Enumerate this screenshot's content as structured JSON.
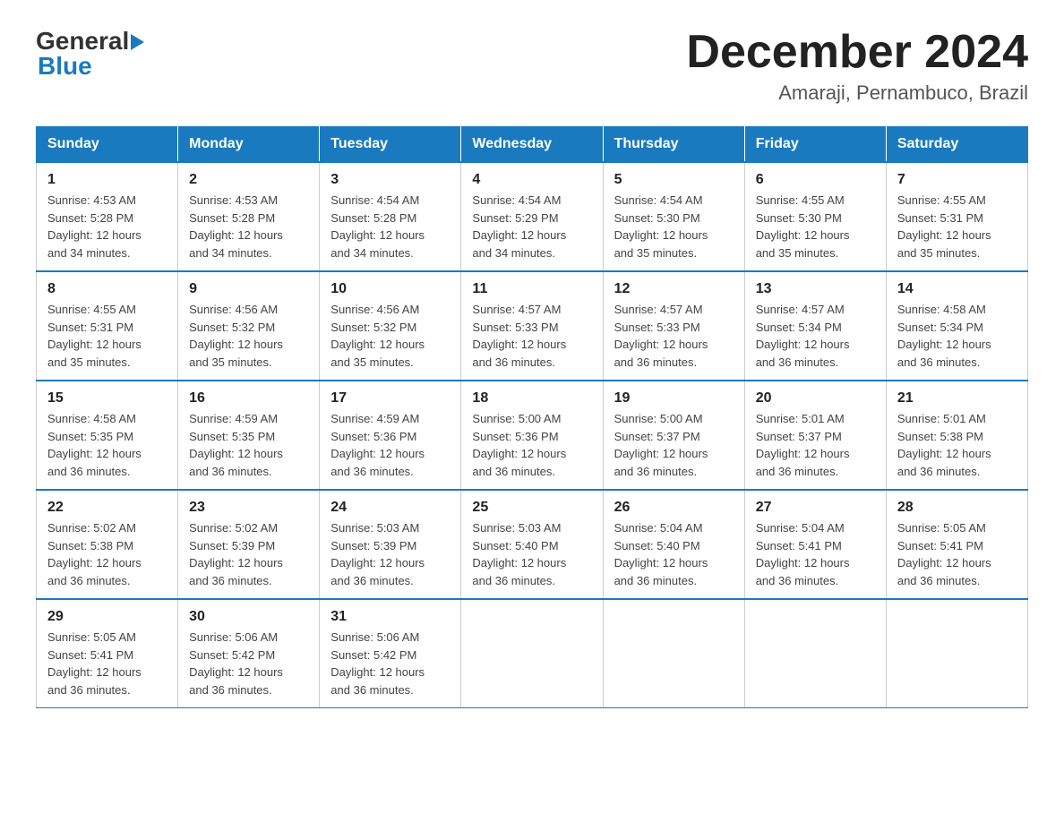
{
  "header": {
    "logo": {
      "general": "General",
      "blue": "Blue"
    },
    "title": "December 2024",
    "location": "Amaraji, Pernambuco, Brazil"
  },
  "days_of_week": [
    "Sunday",
    "Monday",
    "Tuesday",
    "Wednesday",
    "Thursday",
    "Friday",
    "Saturday"
  ],
  "weeks": [
    {
      "days": [
        {
          "num": "1",
          "sunrise": "4:53 AM",
          "sunset": "5:28 PM",
          "daylight": "12 hours and 34 minutes."
        },
        {
          "num": "2",
          "sunrise": "4:53 AM",
          "sunset": "5:28 PM",
          "daylight": "12 hours and 34 minutes."
        },
        {
          "num": "3",
          "sunrise": "4:54 AM",
          "sunset": "5:28 PM",
          "daylight": "12 hours and 34 minutes."
        },
        {
          "num": "4",
          "sunrise": "4:54 AM",
          "sunset": "5:29 PM",
          "daylight": "12 hours and 34 minutes."
        },
        {
          "num": "5",
          "sunrise": "4:54 AM",
          "sunset": "5:30 PM",
          "daylight": "12 hours and 35 minutes."
        },
        {
          "num": "6",
          "sunrise": "4:55 AM",
          "sunset": "5:30 PM",
          "daylight": "12 hours and 35 minutes."
        },
        {
          "num": "7",
          "sunrise": "4:55 AM",
          "sunset": "5:31 PM",
          "daylight": "12 hours and 35 minutes."
        }
      ]
    },
    {
      "days": [
        {
          "num": "8",
          "sunrise": "4:55 AM",
          "sunset": "5:31 PM",
          "daylight": "12 hours and 35 minutes."
        },
        {
          "num": "9",
          "sunrise": "4:56 AM",
          "sunset": "5:32 PM",
          "daylight": "12 hours and 35 minutes."
        },
        {
          "num": "10",
          "sunrise": "4:56 AM",
          "sunset": "5:32 PM",
          "daylight": "12 hours and 35 minutes."
        },
        {
          "num": "11",
          "sunrise": "4:57 AM",
          "sunset": "5:33 PM",
          "daylight": "12 hours and 36 minutes."
        },
        {
          "num": "12",
          "sunrise": "4:57 AM",
          "sunset": "5:33 PM",
          "daylight": "12 hours and 36 minutes."
        },
        {
          "num": "13",
          "sunrise": "4:57 AM",
          "sunset": "5:34 PM",
          "daylight": "12 hours and 36 minutes."
        },
        {
          "num": "14",
          "sunrise": "4:58 AM",
          "sunset": "5:34 PM",
          "daylight": "12 hours and 36 minutes."
        }
      ]
    },
    {
      "days": [
        {
          "num": "15",
          "sunrise": "4:58 AM",
          "sunset": "5:35 PM",
          "daylight": "12 hours and 36 minutes."
        },
        {
          "num": "16",
          "sunrise": "4:59 AM",
          "sunset": "5:35 PM",
          "daylight": "12 hours and 36 minutes."
        },
        {
          "num": "17",
          "sunrise": "4:59 AM",
          "sunset": "5:36 PM",
          "daylight": "12 hours and 36 minutes."
        },
        {
          "num": "18",
          "sunrise": "5:00 AM",
          "sunset": "5:36 PM",
          "daylight": "12 hours and 36 minutes."
        },
        {
          "num": "19",
          "sunrise": "5:00 AM",
          "sunset": "5:37 PM",
          "daylight": "12 hours and 36 minutes."
        },
        {
          "num": "20",
          "sunrise": "5:01 AM",
          "sunset": "5:37 PM",
          "daylight": "12 hours and 36 minutes."
        },
        {
          "num": "21",
          "sunrise": "5:01 AM",
          "sunset": "5:38 PM",
          "daylight": "12 hours and 36 minutes."
        }
      ]
    },
    {
      "days": [
        {
          "num": "22",
          "sunrise": "5:02 AM",
          "sunset": "5:38 PM",
          "daylight": "12 hours and 36 minutes."
        },
        {
          "num": "23",
          "sunrise": "5:02 AM",
          "sunset": "5:39 PM",
          "daylight": "12 hours and 36 minutes."
        },
        {
          "num": "24",
          "sunrise": "5:03 AM",
          "sunset": "5:39 PM",
          "daylight": "12 hours and 36 minutes."
        },
        {
          "num": "25",
          "sunrise": "5:03 AM",
          "sunset": "5:40 PM",
          "daylight": "12 hours and 36 minutes."
        },
        {
          "num": "26",
          "sunrise": "5:04 AM",
          "sunset": "5:40 PM",
          "daylight": "12 hours and 36 minutes."
        },
        {
          "num": "27",
          "sunrise": "5:04 AM",
          "sunset": "5:41 PM",
          "daylight": "12 hours and 36 minutes."
        },
        {
          "num": "28",
          "sunrise": "5:05 AM",
          "sunset": "5:41 PM",
          "daylight": "12 hours and 36 minutes."
        }
      ]
    },
    {
      "days": [
        {
          "num": "29",
          "sunrise": "5:05 AM",
          "sunset": "5:41 PM",
          "daylight": "12 hours and 36 minutes."
        },
        {
          "num": "30",
          "sunrise": "5:06 AM",
          "sunset": "5:42 PM",
          "daylight": "12 hours and 36 minutes."
        },
        {
          "num": "31",
          "sunrise": "5:06 AM",
          "sunset": "5:42 PM",
          "daylight": "12 hours and 36 minutes."
        },
        null,
        null,
        null,
        null
      ]
    }
  ],
  "labels": {
    "sunrise_prefix": "Sunrise: ",
    "sunset_prefix": "Sunset: ",
    "daylight_prefix": "Daylight: "
  }
}
